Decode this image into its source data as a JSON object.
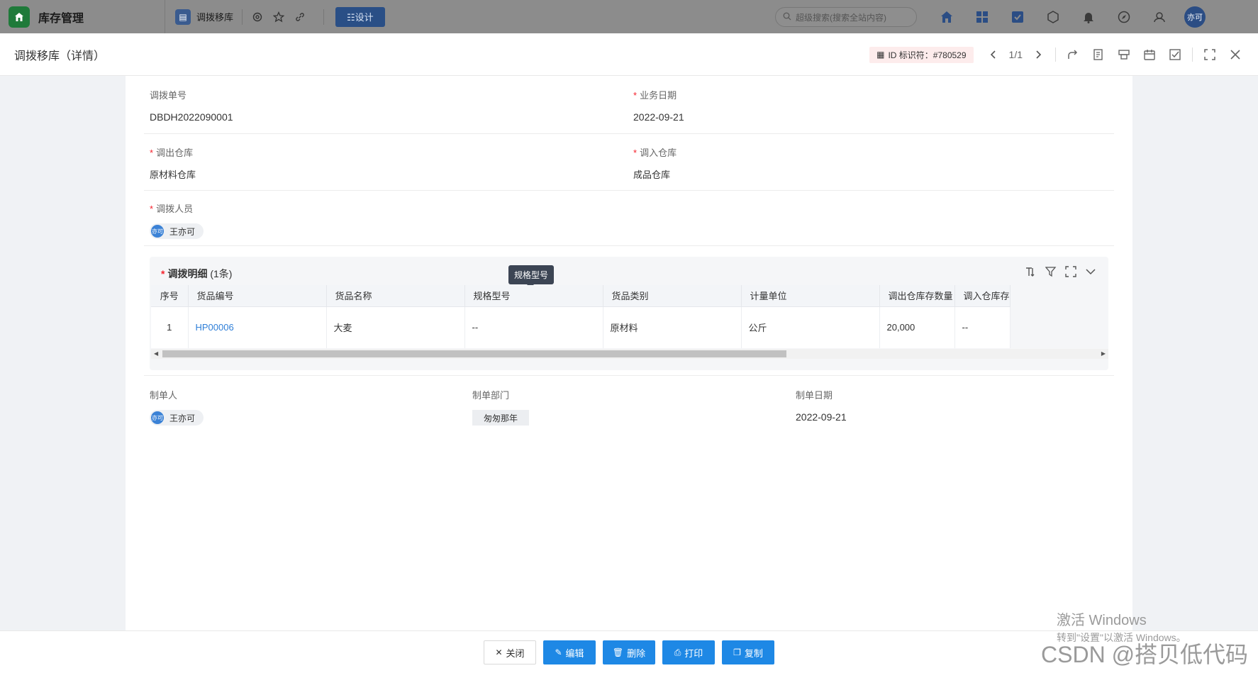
{
  "topbar": {
    "app_title": "库存管理",
    "tab_label": "调拨移库",
    "design_label": "☷设计",
    "search_placeholder": "超级搜索(搜索全站内容)",
    "user_avatar": "亦可"
  },
  "modal": {
    "title": "调拨移库（详情）",
    "id_badge": "ID 标识符：#780529",
    "pager": "1/1"
  },
  "form": {
    "order_no": {
      "label": "调拨单号",
      "value": "DBDH2022090001"
    },
    "biz_date": {
      "label": "业务日期",
      "value": "2022-09-21"
    },
    "out_wh": {
      "label": "调出仓库",
      "value": "原材料仓库"
    },
    "in_wh": {
      "label": "调入仓库",
      "value": "成品仓库"
    },
    "staff": {
      "label": "调拨人员",
      "avatar": "亦可",
      "name": "王亦可"
    }
  },
  "detail": {
    "title": "调拨明细",
    "count": "(1条)",
    "tooltip": "规格型号",
    "columns": [
      "序号",
      "货品编号",
      "货品名称",
      "规格型号",
      "货品类别",
      "计量单位",
      "调出仓库存数量",
      "调入仓库存"
    ],
    "rows": [
      {
        "idx": "1",
        "code": "HP00006",
        "name": "大麦",
        "spec": "--",
        "category": "原材料",
        "unit": "公斤",
        "out_qty": "20,000",
        "in_qty": "--"
      }
    ]
  },
  "footer_fields": {
    "creator": {
      "label": "制单人",
      "avatar": "亦可",
      "name": "王亦可"
    },
    "dept": {
      "label": "制单部门",
      "value": "匆匆那年"
    },
    "created": {
      "label": "制单日期",
      "value": "2022-09-21"
    }
  },
  "buttons": {
    "close": "关闭",
    "edit": "编辑",
    "delete": "删除",
    "print": "打印",
    "copy": "复制"
  },
  "watermarks": {
    "win_line1": "激活 Windows",
    "win_line2": "转到\"设置\"以激活 Windows。",
    "csdn": "CSDN @搭贝低代码"
  },
  "colors": {
    "accent": "#1e88e5",
    "link": "#2f7fd8",
    "required": "#f5222d"
  }
}
